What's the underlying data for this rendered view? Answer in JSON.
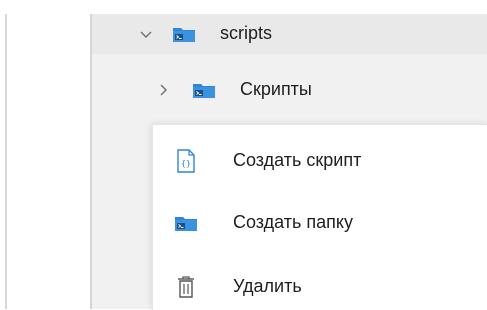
{
  "tree": {
    "items": [
      {
        "label": "scripts",
        "expanded": true,
        "icon": "script-folder-icon"
      },
      {
        "label": "Скрипты",
        "expanded": false,
        "icon": "script-folder-icon"
      }
    ]
  },
  "context_menu": {
    "items": [
      {
        "label": "Создать скрипт",
        "icon": "script-file-icon"
      },
      {
        "label": "Создать папку",
        "icon": "script-folder-icon"
      },
      {
        "label": "Удалить",
        "icon": "trash-icon"
      }
    ]
  },
  "colors": {
    "folder_blue": "#2f86d6",
    "folder_dark": "#1b4f82",
    "accent": "#2f86d6",
    "text": "#1f1f1f",
    "tree_background": "#f1f1f1",
    "selected_row": "#e9e9e9"
  }
}
